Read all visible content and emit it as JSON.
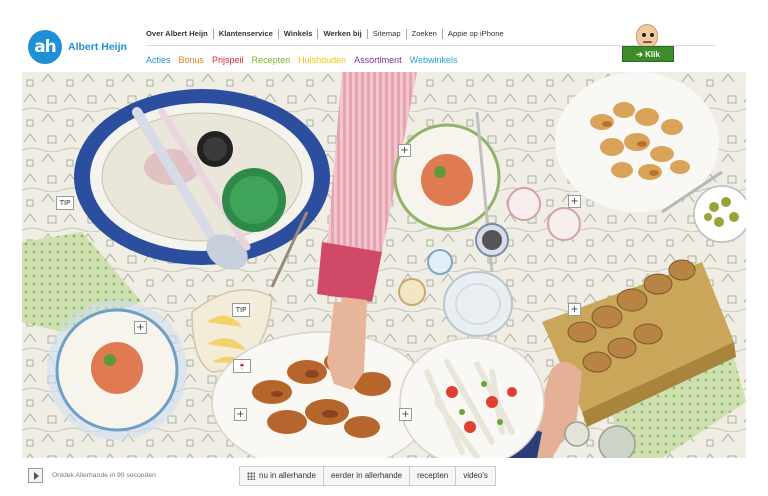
{
  "brand": {
    "logo_mark": "ah",
    "name": "Albert Heijn",
    "accent": "#1f8fd6"
  },
  "topnav": [
    {
      "label": "Over Albert Heijn",
      "bold": true
    },
    {
      "label": "Klantenservice",
      "bold": true
    },
    {
      "label": "Winkels",
      "bold": true
    },
    {
      "label": "Werken bij",
      "bold": true
    },
    {
      "label": "Sitemap",
      "bold": false
    },
    {
      "label": "Zoeken",
      "bold": false
    },
    {
      "label": "Appie op iPhone",
      "bold": false
    }
  ],
  "mainnav": [
    {
      "label": "Acties",
      "color": "#1f8fd6"
    },
    {
      "label": "Bonus",
      "color": "#f07c1c"
    },
    {
      "label": "Prijspeil",
      "color": "#e0262f"
    },
    {
      "label": "Recepten",
      "color": "#7cb51f"
    },
    {
      "label": "Huishouden",
      "color": "#f5c400"
    },
    {
      "label": "Assortiment",
      "color": "#7a2d8f"
    },
    {
      "label": "Webwinkels",
      "color": "#1fa6d6"
    }
  ],
  "klik": {
    "label": "➔ Klik",
    "icon": "appie-mascot-icon"
  },
  "hero": {
    "markers": {
      "plus": "+",
      "tip": "TIP",
      "glass_icon": "wine-glass-icon"
    }
  },
  "footer": {
    "play_label": "Ontdek Allerhande in 90 seconden",
    "tabs": [
      "nu in allerhande",
      "eerder in allerhande",
      "recepten",
      "video's"
    ]
  }
}
